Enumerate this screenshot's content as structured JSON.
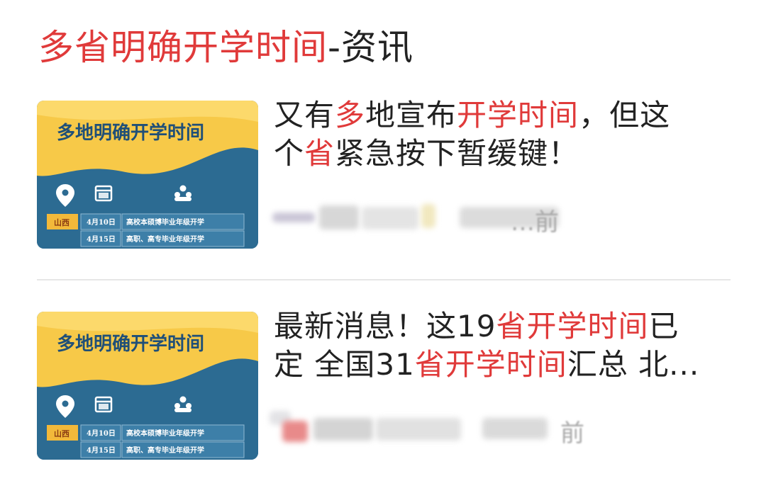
{
  "header": {
    "parts": [
      {
        "text": "多省明确开学时间",
        "highlight": true
      },
      {
        "text": "-资讯",
        "highlight": false
      }
    ]
  },
  "colors": {
    "highlight": "#e03a3a",
    "text": "#222222",
    "meta": "#a8a8a8",
    "thumb_banner": "#f7c948",
    "thumb_body": "#2c6b92"
  },
  "articles": [
    {
      "title_lines": [
        [
          {
            "text": "又有",
            "highlight": false
          },
          {
            "text": "多",
            "highlight": true
          },
          {
            "text": "地宣布",
            "highlight": false
          },
          {
            "text": "开学时间",
            "highlight": true
          },
          {
            "text": "，但这",
            "highlight": false
          }
        ],
        [
          {
            "text": "个",
            "highlight": false
          },
          {
            "text": "省",
            "highlight": true
          },
          {
            "text": "紧急按下暂缓键！",
            "highlight": false
          }
        ]
      ],
      "meta_time": "…前",
      "thumbnail": {
        "headline": "多地明确开学时间",
        "icons": [
          "location-pin-icon",
          "calendar-icon",
          "people-icon"
        ],
        "region": "山西",
        "rows": [
          {
            "date": "4月10日",
            "desc": "高校本硕博毕业年级开学"
          },
          {
            "date": "4月15日",
            "desc": "高职、高专毕业年级开学"
          }
        ]
      }
    },
    {
      "title_lines": [
        [
          {
            "text": "最新消息！这19",
            "highlight": false
          },
          {
            "text": "省开学时间",
            "highlight": true
          },
          {
            "text": "已",
            "highlight": false
          }
        ],
        [
          {
            "text": "定 全国31",
            "highlight": false
          },
          {
            "text": "省开学时间",
            "highlight": true
          },
          {
            "text": "汇总 北...",
            "highlight": false
          }
        ]
      ],
      "meta_time": "前",
      "thumbnail": {
        "headline": "多地明确开学时间",
        "icons": [
          "location-pin-icon",
          "calendar-icon",
          "people-icon"
        ],
        "region": "山西",
        "rows": [
          {
            "date": "4月10日",
            "desc": "高校本硕博毕业年级开学"
          },
          {
            "date": "4月15日",
            "desc": "高职、高专毕业年级开学"
          }
        ]
      }
    }
  ]
}
